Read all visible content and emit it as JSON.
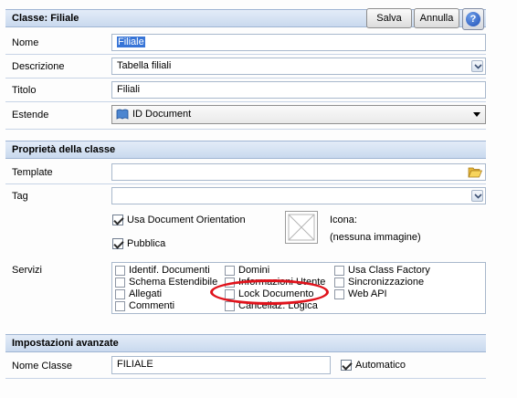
{
  "header": {
    "title": "Classe: Filiale",
    "save_label": "Salva",
    "cancel_label": "Annulla",
    "help_icon": "help-icon"
  },
  "fields": {
    "nome": {
      "label": "Nome",
      "value": "Filiale"
    },
    "descrizione": {
      "label": "Descrizione",
      "value": "Tabella filiali"
    },
    "titolo": {
      "label": "Titolo",
      "value": "Filiali"
    },
    "estende": {
      "label": "Estende",
      "value": "ID Document"
    }
  },
  "properties": {
    "section_title": "Proprietà della classe",
    "template": {
      "label": "Template",
      "value": ""
    },
    "tag": {
      "label": "Tag",
      "value": ""
    },
    "usa_doc_orientation": {
      "label": "Usa Document Orientation",
      "checked": true
    },
    "pubblica": {
      "label": "Pubblica",
      "checked": true
    },
    "icona": {
      "label": "Icona:",
      "value": "(nessuna immagine)"
    },
    "servizi": {
      "label": "Servizi",
      "items": [
        {
          "label": "Identif. Documenti",
          "checked": false
        },
        {
          "label": "Schema Estendibile",
          "checked": false
        },
        {
          "label": "Allegati",
          "checked": false
        },
        {
          "label": "Commenti",
          "checked": false
        },
        {
          "label": "Domini",
          "checked": false
        },
        {
          "label": "Informazioni Utente",
          "checked": false
        },
        {
          "label": "Lock Documento",
          "checked": false
        },
        {
          "label": "Cancellaz. Logica",
          "checked": false
        },
        {
          "label": "Usa Class Factory",
          "checked": false
        },
        {
          "label": "Sincronizzazione",
          "checked": false
        },
        {
          "label": "Web API",
          "checked": false
        }
      ]
    }
  },
  "advanced": {
    "section_title": "Impostazioni avanzate",
    "nome_classe": {
      "label": "Nome Classe",
      "value": "FILIALE"
    },
    "automatico": {
      "label": "Automatico",
      "checked": true
    }
  },
  "colors": {
    "accent": "#c9d9ee",
    "highlight": "#3875d7",
    "annotation": "#e0121b"
  }
}
